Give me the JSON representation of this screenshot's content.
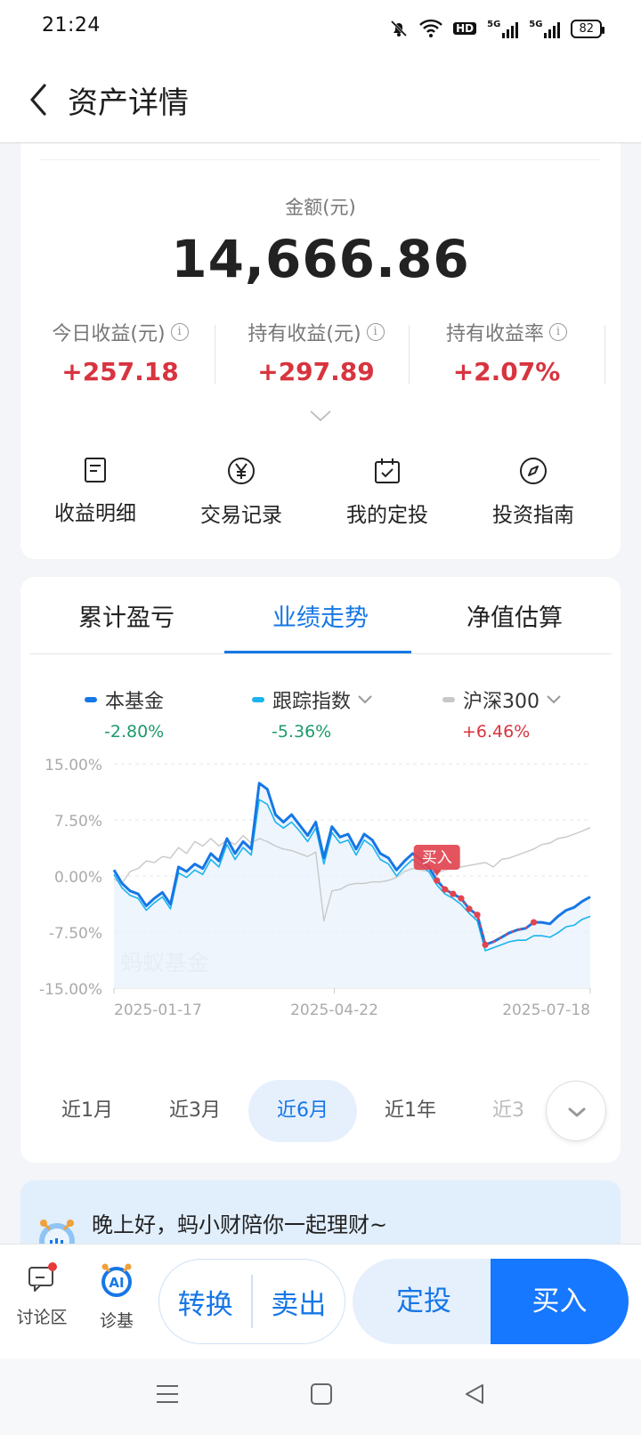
{
  "status_bar": {
    "time": "21:24",
    "network": "HD",
    "signal1": "5G",
    "signal2": "5G",
    "battery": "82"
  },
  "header": {
    "title": "资产详情"
  },
  "summary": {
    "amount_label": "金额(元)",
    "amount_value": "14,666.86",
    "stats": [
      {
        "label": "今日收益(元)",
        "value": "+257.18"
      },
      {
        "label": "持有收益(元)",
        "value": "+297.89"
      },
      {
        "label": "持有收益率",
        "value": "+2.07%"
      }
    ],
    "actions": [
      {
        "label": "收益明细",
        "icon": "document-icon"
      },
      {
        "label": "交易记录",
        "icon": "yen-circle-icon"
      },
      {
        "label": "我的定投",
        "icon": "calendar-check-icon"
      },
      {
        "label": "投资指南",
        "icon": "compass-icon"
      }
    ]
  },
  "tabs": [
    "累计盈亏",
    "业绩走势",
    "净值估算"
  ],
  "active_tab": "业绩走势",
  "legend": [
    {
      "name": "本基金",
      "value": "-2.80%",
      "color": "#1677e6",
      "value_color": "#1f9a6b"
    },
    {
      "name": "跟踪指数",
      "value": "-5.36%",
      "color": "#1ab4ee",
      "value_color": "#1f9a6b"
    },
    {
      "name": "沪深300",
      "value": "+6.46%",
      "color": "#c8c8c8",
      "value_color": "#d8343f"
    }
  ],
  "chart_data": {
    "type": "line",
    "y_ticks": [
      "15.00%",
      "7.50%",
      "0.00%",
      "-7.50%",
      "-15.00%"
    ],
    "ylim": [
      -15,
      15
    ],
    "x_ticks": [
      "2025-01-17",
      "2025-04-22",
      "2025-07-18"
    ],
    "watermark": "蚂蚁基金",
    "buy_marker_label": "买入",
    "series": [
      {
        "name": "本基金",
        "color": "#1677e6",
        "values": [
          0.8,
          -1.0,
          -2.0,
          -2.4,
          -4.0,
          -3.0,
          -2.2,
          -3.8,
          1.2,
          0.6,
          1.6,
          1.0,
          3.0,
          2.0,
          5.0,
          3.0,
          4.6,
          3.6,
          12.4,
          11.6,
          8.2,
          7.2,
          8.2,
          6.8,
          5.4,
          7.2,
          2.4,
          6.6,
          5.2,
          5.6,
          3.6,
          5.6,
          4.8,
          3.0,
          2.4,
          0.8,
          2.0,
          3.0,
          2.2,
          1.2,
          -0.6,
          -1.8,
          -2.4,
          -3.0,
          -4.4,
          -5.2,
          -9.2,
          -8.8,
          -8.2,
          -7.6,
          -7.2,
          -7.0,
          -6.2,
          -6.2,
          -6.4,
          -5.4,
          -4.6,
          -4.2,
          -3.4,
          -2.8
        ]
      },
      {
        "name": "跟踪指数",
        "color": "#1ab4ee",
        "values": [
          0.2,
          -1.6,
          -2.6,
          -3.0,
          -4.6,
          -3.6,
          -2.8,
          -4.4,
          0.4,
          -0.2,
          0.8,
          0.2,
          2.2,
          1.2,
          4.2,
          2.2,
          3.8,
          2.8,
          10.2,
          9.6,
          7.2,
          6.4,
          7.2,
          6.0,
          4.6,
          6.4,
          1.6,
          5.8,
          4.4,
          4.8,
          2.8,
          4.8,
          4.0,
          2.2,
          1.6,
          0.0,
          1.2,
          2.2,
          1.4,
          0.6,
          -1.2,
          -2.4,
          -3.0,
          -3.8,
          -5.0,
          -6.0,
          -10.0,
          -9.6,
          -9.2,
          -8.8,
          -8.6,
          -8.6,
          -8.0,
          -8.0,
          -8.2,
          -7.6,
          -6.8,
          -6.6,
          -5.8,
          -5.4
        ]
      },
      {
        "name": "沪深300",
        "color": "#c8c8c8",
        "values": [
          -0.4,
          -1.0,
          0.6,
          1.0,
          2.0,
          1.8,
          2.6,
          2.4,
          3.8,
          3.0,
          4.6,
          4.0,
          5.0,
          4.0,
          4.8,
          4.2,
          5.4,
          4.4,
          5.0,
          4.6,
          4.0,
          3.6,
          3.4,
          3.0,
          2.6,
          3.2,
          -6.0,
          -2.0,
          -1.8,
          -1.2,
          -1.0,
          -1.0,
          -0.8,
          -0.8,
          -0.6,
          -0.2,
          0.6,
          1.0,
          0.8,
          0.6,
          0.4,
          0.8,
          1.0,
          1.2,
          1.4,
          1.6,
          1.8,
          1.2,
          2.2,
          2.4,
          2.8,
          3.2,
          3.6,
          4.2,
          4.4,
          5.0,
          5.2,
          5.6,
          6.0,
          6.46
        ]
      }
    ],
    "buy_points_index": [
      40,
      41,
      42,
      43,
      44,
      45,
      46,
      52
    ]
  },
  "ranges": [
    "近1月",
    "近3月",
    "近6月",
    "近1年",
    "近3"
  ],
  "active_range": "近6月",
  "greeting": "晚上好，蚂小财陪你一起理财~",
  "bottom_bar": {
    "discussion": "讨论区",
    "diagnose": "诊基",
    "ai_badge": "AI",
    "convert": "转换",
    "sell": "卖出",
    "sip": "定投",
    "buy": "买入"
  }
}
